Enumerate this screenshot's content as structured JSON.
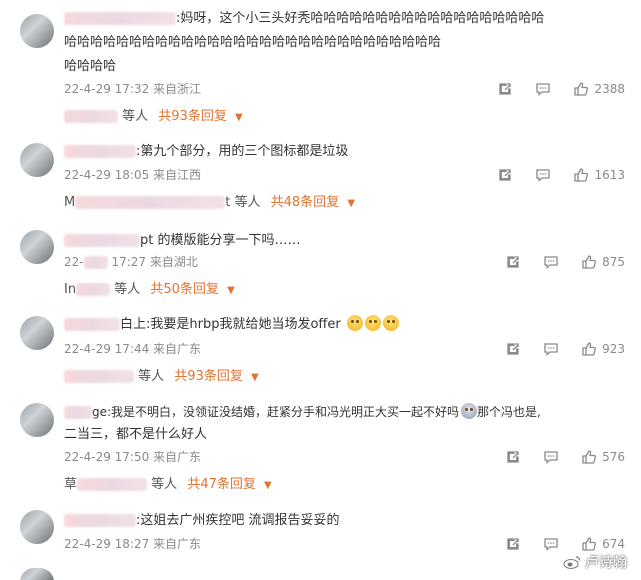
{
  "comments": [
    {
      "text1": ":妈呀，这个小三头好秃哈哈哈哈哈哈哈哈哈哈哈哈哈哈哈哈哈哈",
      "text2": "哈哈哈哈哈哈哈哈哈哈哈哈哈哈哈哈哈哈哈哈哈哈哈哈哈哈哈哈哈",
      "text3": "哈哈哈哈",
      "date": "22-4-29 17:32 来自浙江",
      "likes": "2388",
      "reply_suffix": "等人",
      "reply_total": "共93条回复"
    },
    {
      "text1": ":第九个部分，用的三个图标都是垃圾",
      "date": "22-4-29 18:05 来自江西",
      "likes": "1613",
      "reply_prefix": "M",
      "reply_middle": "t",
      "reply_suffix": "等人",
      "reply_total": "共48条回复"
    },
    {
      "text1": "pt 的模版能分享一下吗……",
      "date_prefix": "22-",
      "date": "17:27 来自湖北",
      "likes": "875",
      "reply_prefix": "In",
      "reply_suffix": "等人",
      "reply_total": "共50条回复"
    },
    {
      "text1_prefix": "白上",
      "text1": ":我要是hrbp我就给她当场发offer",
      "date": "22-4-29 17:44 来自广东",
      "likes": "923",
      "reply_suffix": "等人",
      "reply_total": "共93条回复"
    },
    {
      "text1_prefix": "ge",
      "text1": ":我是不明白，没领证没结婚，赶紧分手和冯光明正大买一起不好吗",
      "text1_tail": "那个冯也是,",
      "text2": "二当三，都不是什么好人",
      "date": "22-4-29 17:50 来自广东",
      "likes": "576",
      "reply_prefix": "草",
      "reply_suffix": "等人",
      "reply_total": "共47条回复"
    },
    {
      "text1": ":这姐去广州疾控吧  流调报告妥妥的",
      "date": "22-4-29 18:27 来自广东",
      "likes": "674"
    }
  ],
  "watermark": "卢诗翰",
  "icons": {
    "share": "share-icon",
    "comment": "comment-icon",
    "like": "thumbs-up-icon",
    "caret": "caret-down-icon"
  },
  "accent_color": "#e37330"
}
